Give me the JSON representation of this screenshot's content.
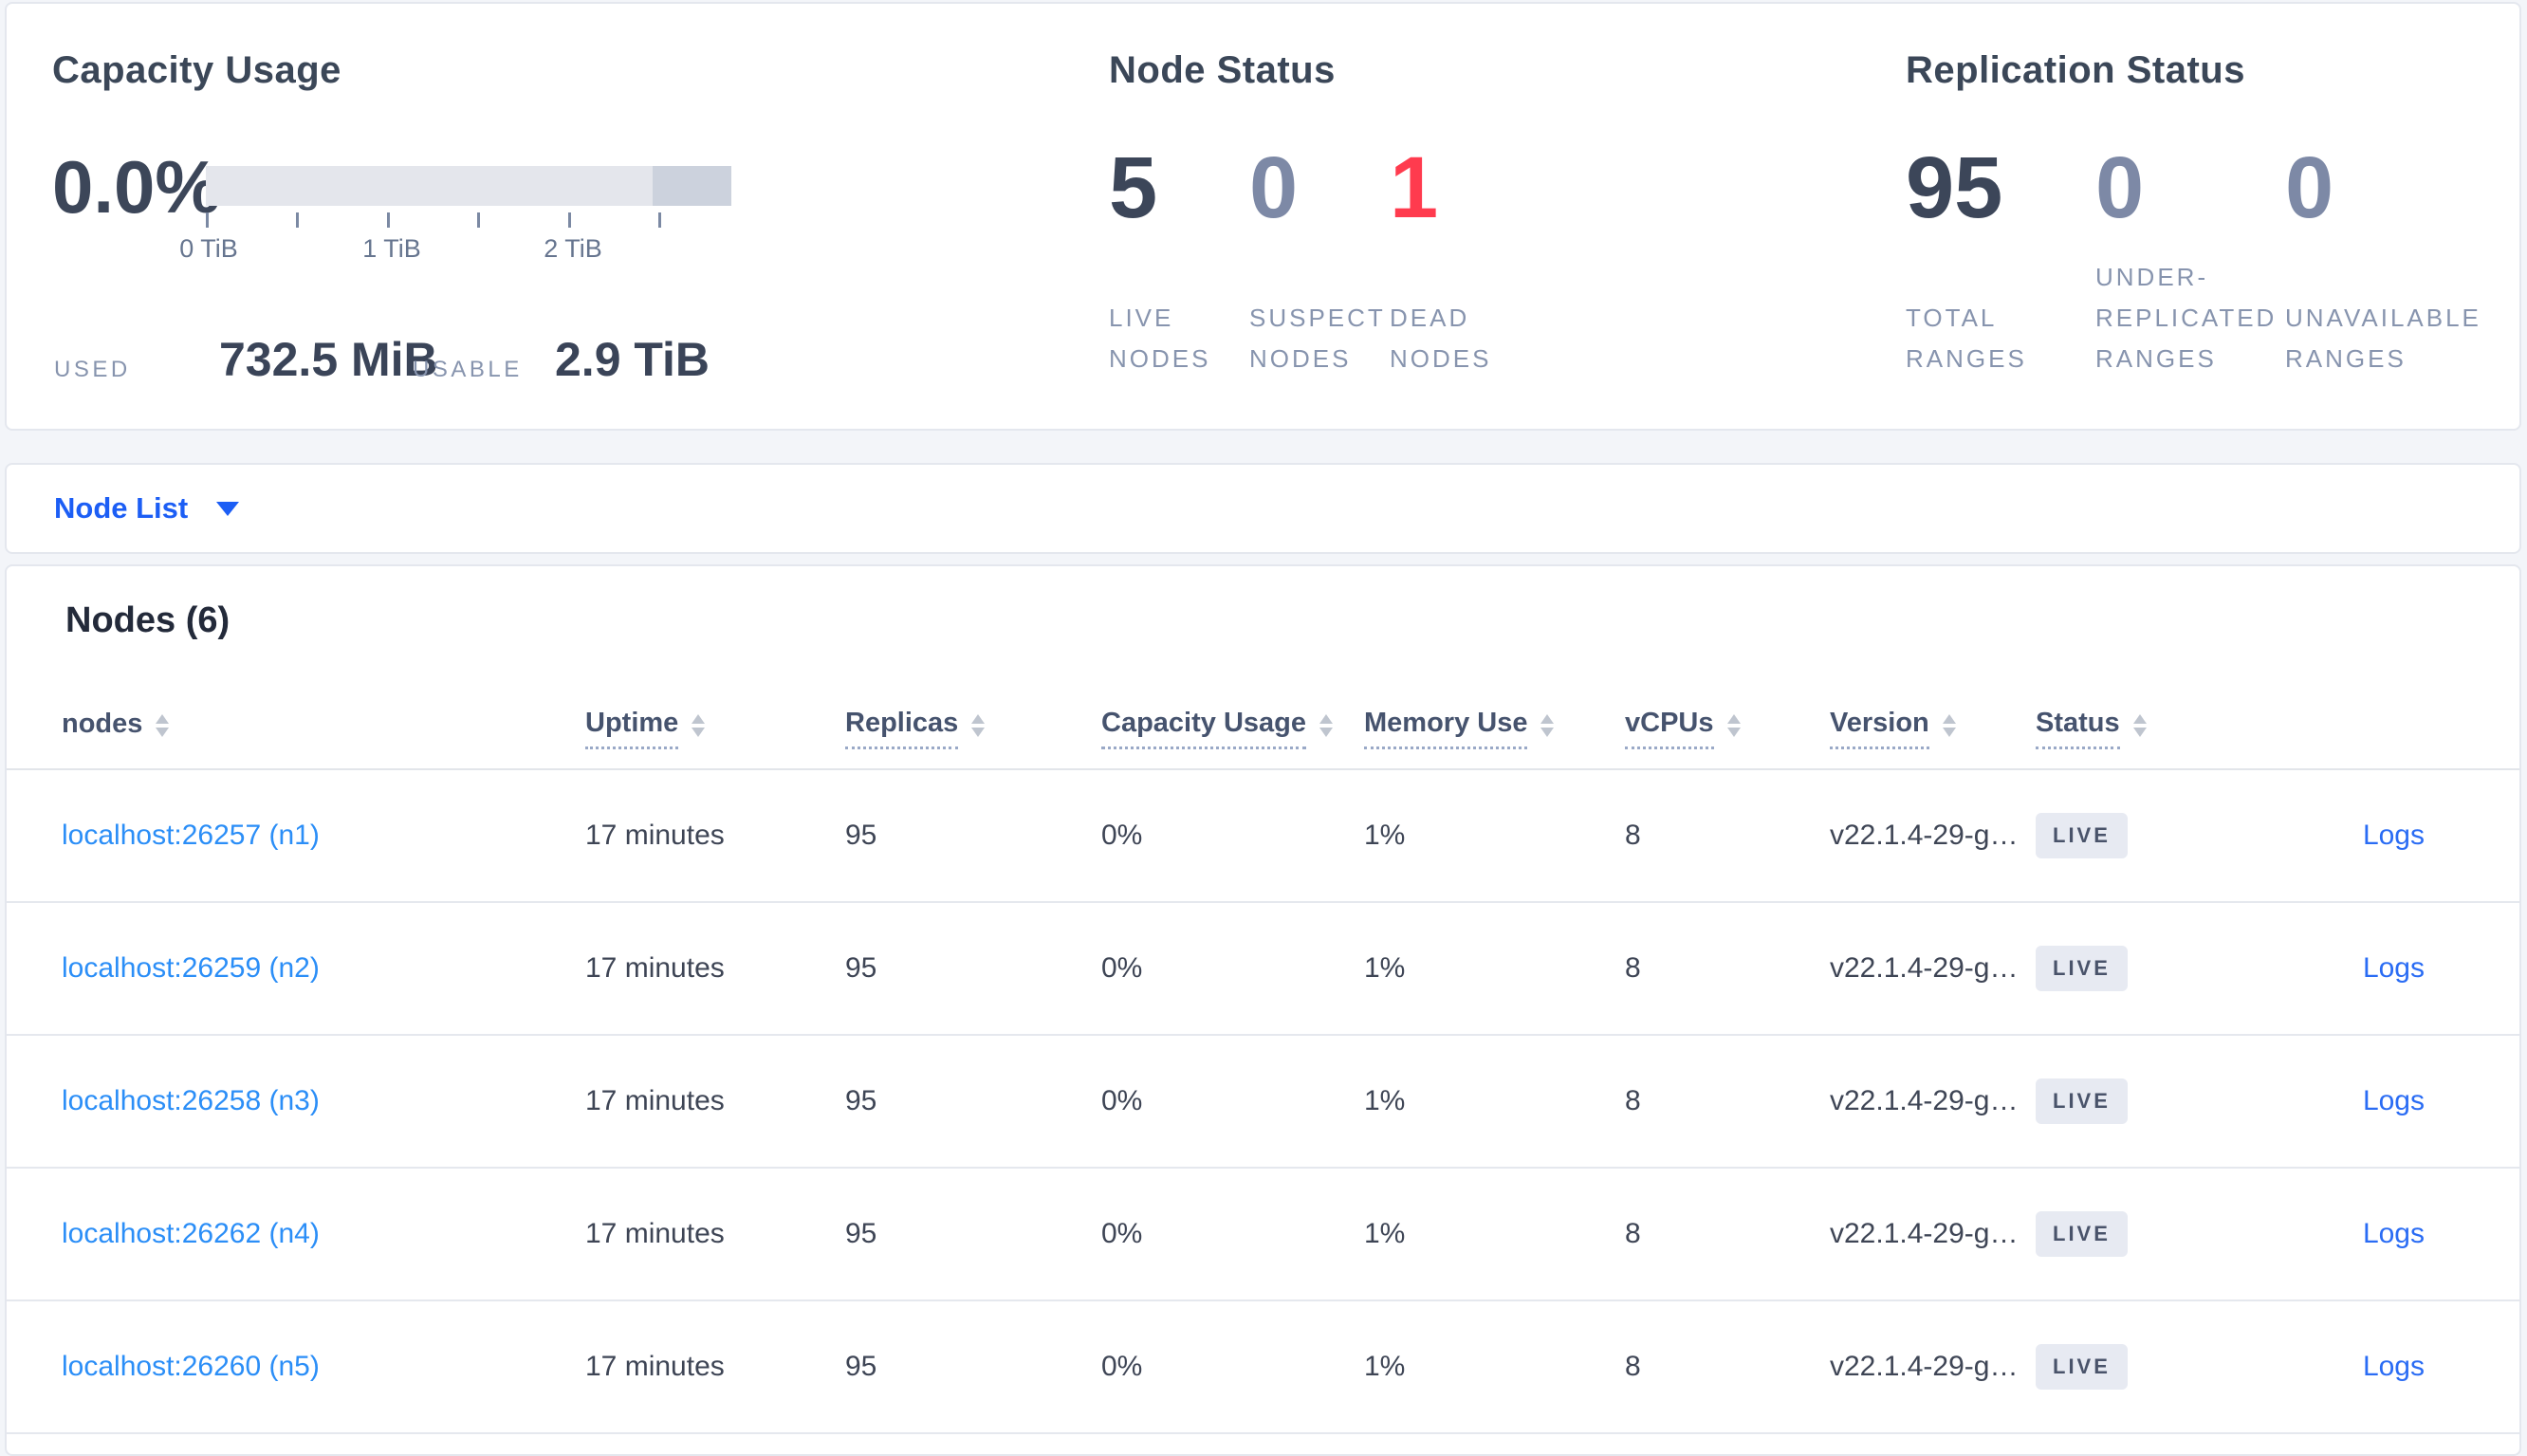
{
  "colors": {
    "accent_blue": "#1c5ef5",
    "node_link_blue": "#2b8ef7",
    "logs_link_blue": "#2a6cf4",
    "danger_red": "#ff3b4e",
    "muted_slate": "#7d89a6",
    "dark_slate": "#3c4659",
    "badge_bg": "#e7eaf2"
  },
  "summary": {
    "capacity": {
      "title": "Capacity Usage",
      "percent": "0.0%",
      "gauge": {
        "tick_labels": [
          "0 TiB",
          "1 TiB",
          "2 TiB"
        ],
        "used_fraction": 0.0,
        "max": "2.9 TiB"
      },
      "used_label": "USED",
      "used_value": "732.5 MiB",
      "usable_label": "USABLE",
      "usable_value": "2.9 TiB"
    },
    "node_status": {
      "title": "Node Status",
      "stats": [
        {
          "value": "5",
          "label_lines": [
            "LIVE",
            "NODES"
          ]
        },
        {
          "value": "0",
          "label_lines": [
            "SUSPECT",
            "NODES"
          ]
        },
        {
          "value": "1",
          "label_lines": [
            "DEAD",
            "NODES"
          ]
        }
      ]
    },
    "replication_status": {
      "title": "Replication Status",
      "stats": [
        {
          "value": "95",
          "label_lines": [
            "TOTAL",
            "RANGES"
          ]
        },
        {
          "value": "0",
          "label_lines": [
            "UNDER-",
            "REPLICATED",
            "RANGES"
          ]
        },
        {
          "value": "0",
          "label_lines": [
            "UNAVAILABLE",
            "RANGES"
          ]
        }
      ]
    }
  },
  "view_selector": {
    "label": "Node List"
  },
  "table": {
    "title": "Nodes (6)",
    "logs_label": "Logs",
    "columns": [
      {
        "label": "nodes"
      },
      {
        "label": "Uptime"
      },
      {
        "label": "Replicas"
      },
      {
        "label": "Capacity Usage"
      },
      {
        "label": "Memory Use"
      },
      {
        "label": "vCPUs"
      },
      {
        "label": "Version"
      },
      {
        "label": "Status"
      }
    ],
    "rows": [
      {
        "node": "localhost:26257 (n1)",
        "uptime": "17 minutes",
        "replicas": "95",
        "capacity": "0%",
        "memory": "1%",
        "vcpus": "8",
        "version": "v22.1.4-29-g…",
        "status": "LIVE"
      },
      {
        "node": "localhost:26259 (n2)",
        "uptime": "17 minutes",
        "replicas": "95",
        "capacity": "0%",
        "memory": "1%",
        "vcpus": "8",
        "version": "v22.1.4-29-g…",
        "status": "LIVE"
      },
      {
        "node": "localhost:26258 (n3)",
        "uptime": "17 minutes",
        "replicas": "95",
        "capacity": "0%",
        "memory": "1%",
        "vcpus": "8",
        "version": "v22.1.4-29-g…",
        "status": "LIVE"
      },
      {
        "node": "localhost:26262 (n4)",
        "uptime": "17 minutes",
        "replicas": "95",
        "capacity": "0%",
        "memory": "1%",
        "vcpus": "8",
        "version": "v22.1.4-29-g…",
        "status": "LIVE"
      },
      {
        "node": "localhost:26260 (n5)",
        "uptime": "17 minutes",
        "replicas": "95",
        "capacity": "0%",
        "memory": "1%",
        "vcpus": "8",
        "version": "v22.1.4-29-g…",
        "status": "LIVE"
      }
    ]
  }
}
